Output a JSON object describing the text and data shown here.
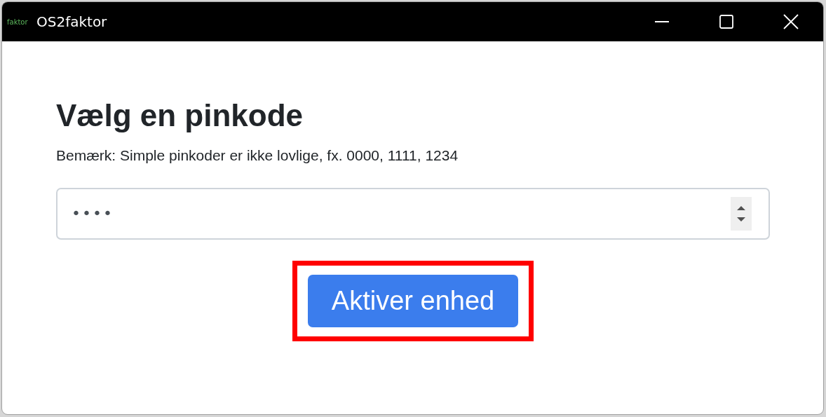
{
  "window": {
    "title": "OS2faktor",
    "logo_text": "faktor"
  },
  "heading": "Vælg en pinkode",
  "note": "Bemærk: Simple pinkoder er ikke lovlige, fx. 0000, 1111, 1234",
  "pin_field": {
    "value": "••••"
  },
  "button": {
    "label": "Aktiver enhed",
    "highlighted": true
  }
}
